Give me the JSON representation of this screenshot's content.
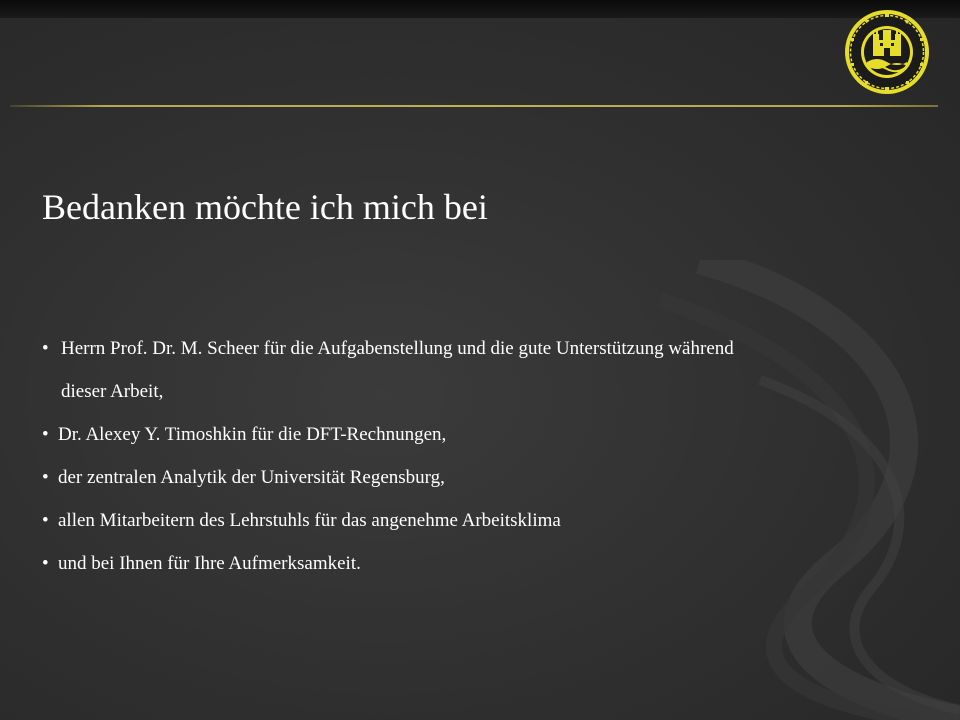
{
  "slide": {
    "title": "Bedanken möchte ich mich bei",
    "bullets": [
      {
        "line1": "Herrn Prof. Dr. M. Scheer für die Aufgabenstellung und die gute Unterstützung während",
        "line2": "dieser Arbeit,"
      },
      {
        "text": "Dr. Alexey Y. Timoshkin für die DFT-Rechnungen,"
      },
      {
        "text": "der zentralen Analytik der Universität Regensburg,"
      },
      {
        "text": "allen Mitarbeitern des Lehrstuhls für das angenehme Arbeitsklima"
      },
      {
        "text": "und bei Ihnen für Ihre Aufmerksamkeit."
      }
    ],
    "bullet_glyph": "•"
  },
  "seal": {
    "icon": "university-seal-icon",
    "color": "#e6dc2a"
  },
  "theme": {
    "background": "#303030",
    "accent_rule": "#b8a84a",
    "text": "#ffffff"
  }
}
